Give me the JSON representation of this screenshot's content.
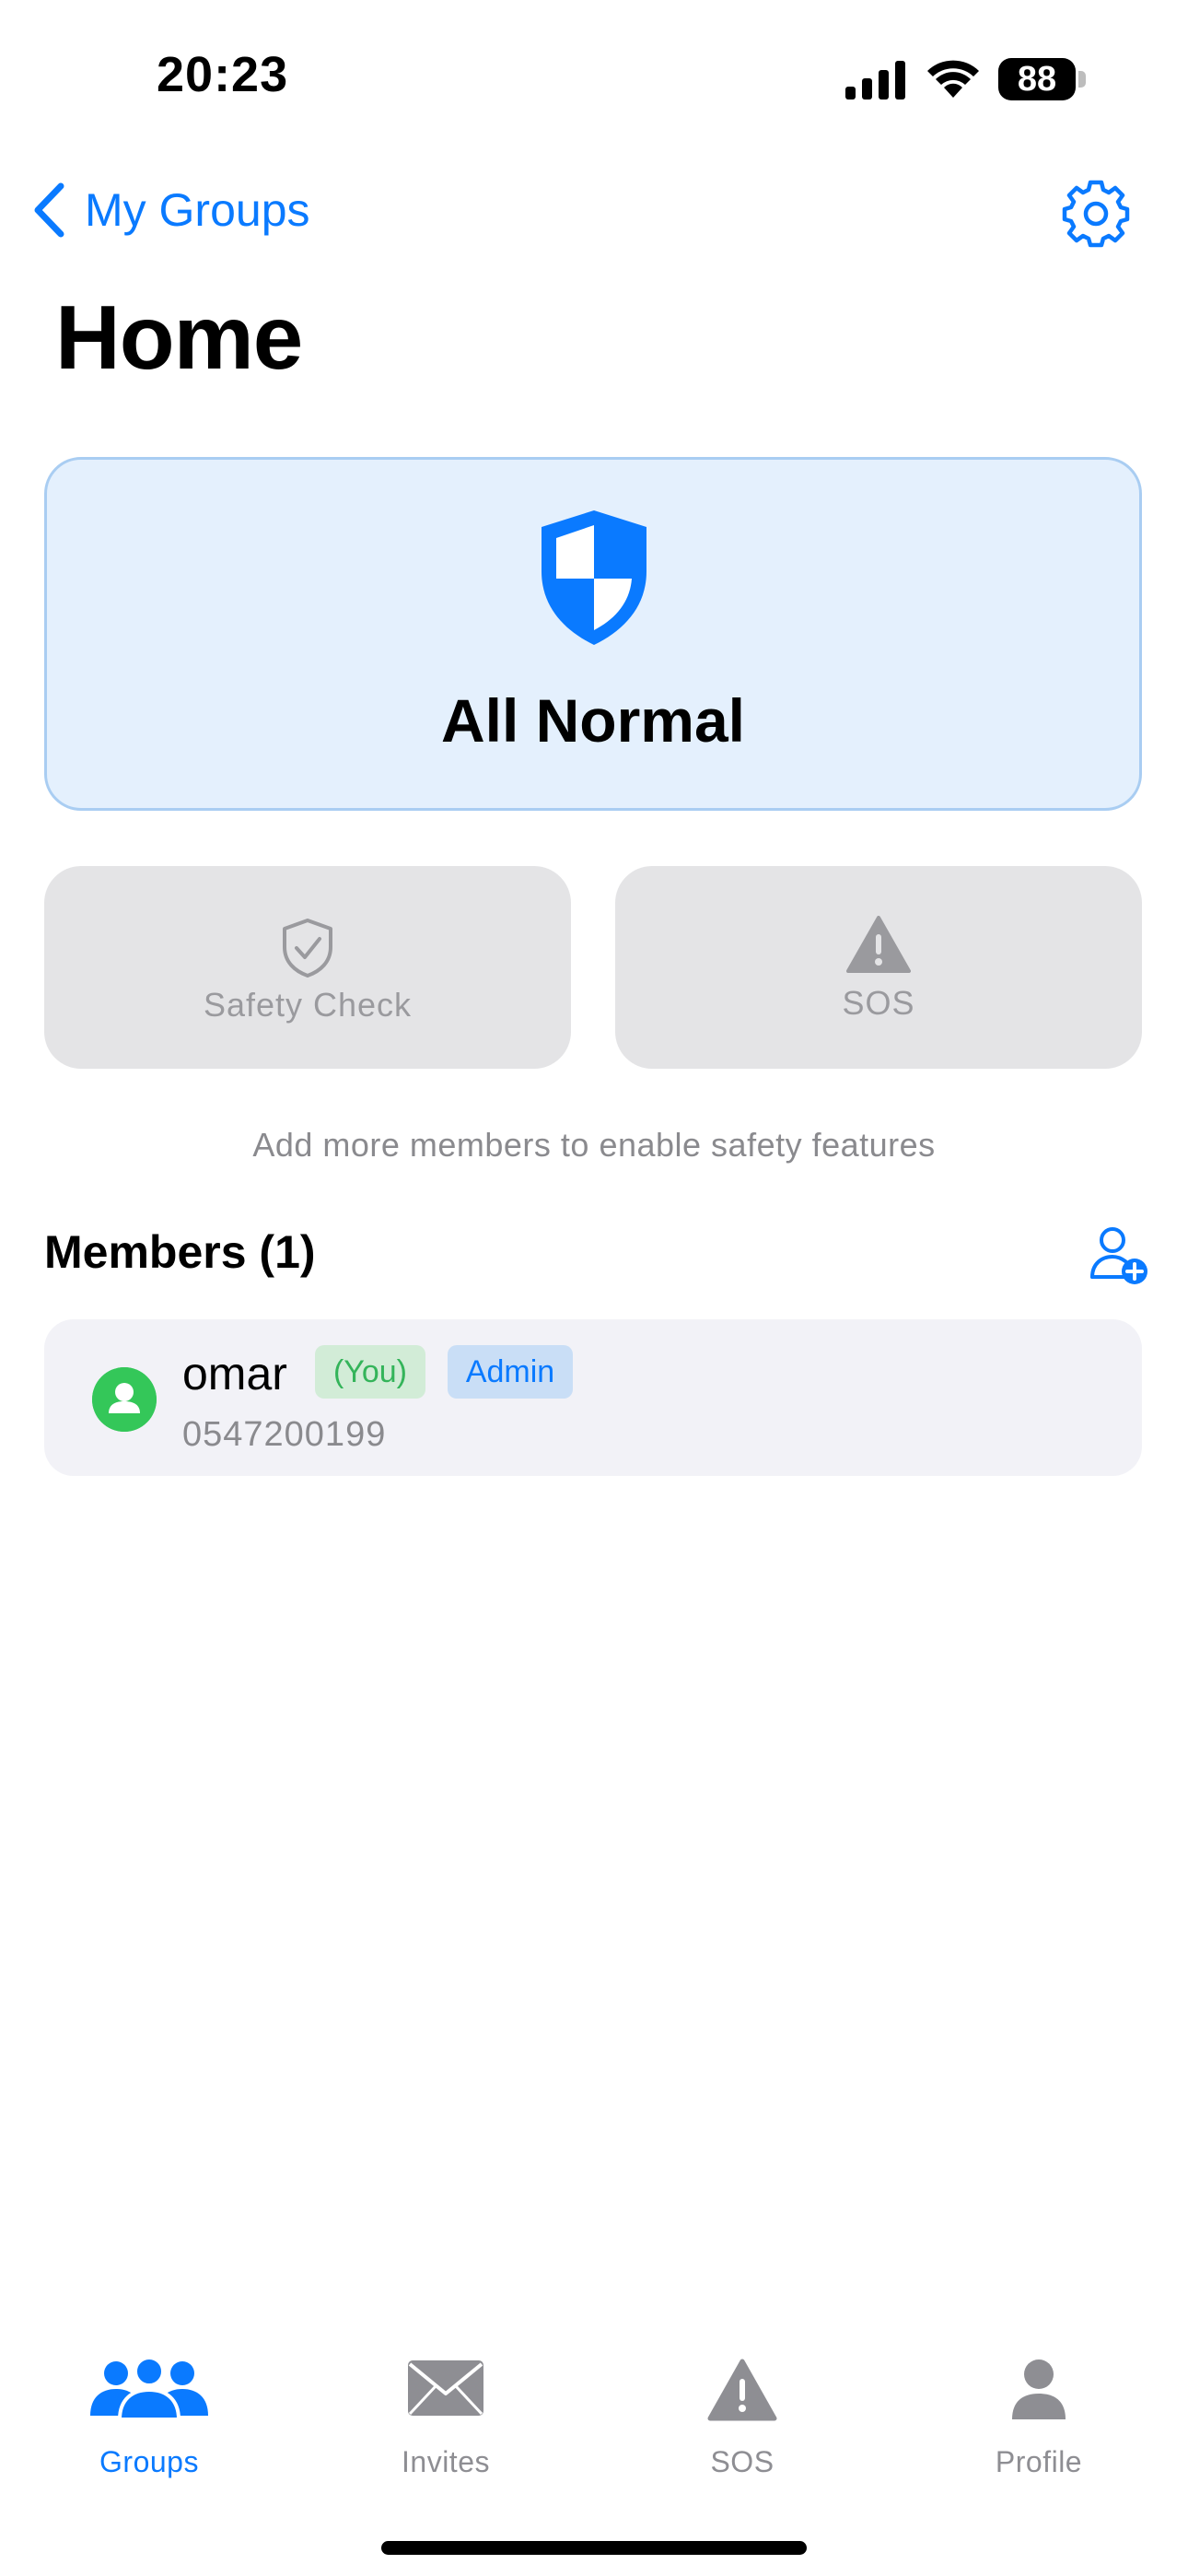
{
  "status_bar": {
    "time": "20:23",
    "battery": "88"
  },
  "nav": {
    "back_label": "My Groups",
    "back_icon": "chevron-left-icon",
    "settings_icon": "gear-icon"
  },
  "page": {
    "title": "Home"
  },
  "status_card": {
    "icon": "shield-icon",
    "label": "All Normal",
    "color": "#0a7aff"
  },
  "actions": [
    {
      "label": "Safety Check",
      "icon": "shield-check-icon",
      "enabled": false
    },
    {
      "label": "SOS",
      "icon": "warning-triangle-icon",
      "enabled": false
    }
  ],
  "hint": "Add more members to enable safety features",
  "members": {
    "title": "Members (1)",
    "add_icon": "add-person-icon",
    "list": [
      {
        "name": "omar",
        "you_badge": "(You)",
        "role_badge": "Admin",
        "phone": "0547200199"
      }
    ]
  },
  "tabs": [
    {
      "label": "Groups",
      "icon": "groups-icon",
      "active": true
    },
    {
      "label": "Invites",
      "icon": "envelope-icon",
      "active": false
    },
    {
      "label": "SOS",
      "icon": "warning-triangle-icon",
      "active": false
    },
    {
      "label": "Profile",
      "icon": "person-icon",
      "active": false
    }
  ],
  "colors": {
    "accent": "#0a7aff",
    "success": "#34c759",
    "disabled": "#9a9a9e"
  }
}
